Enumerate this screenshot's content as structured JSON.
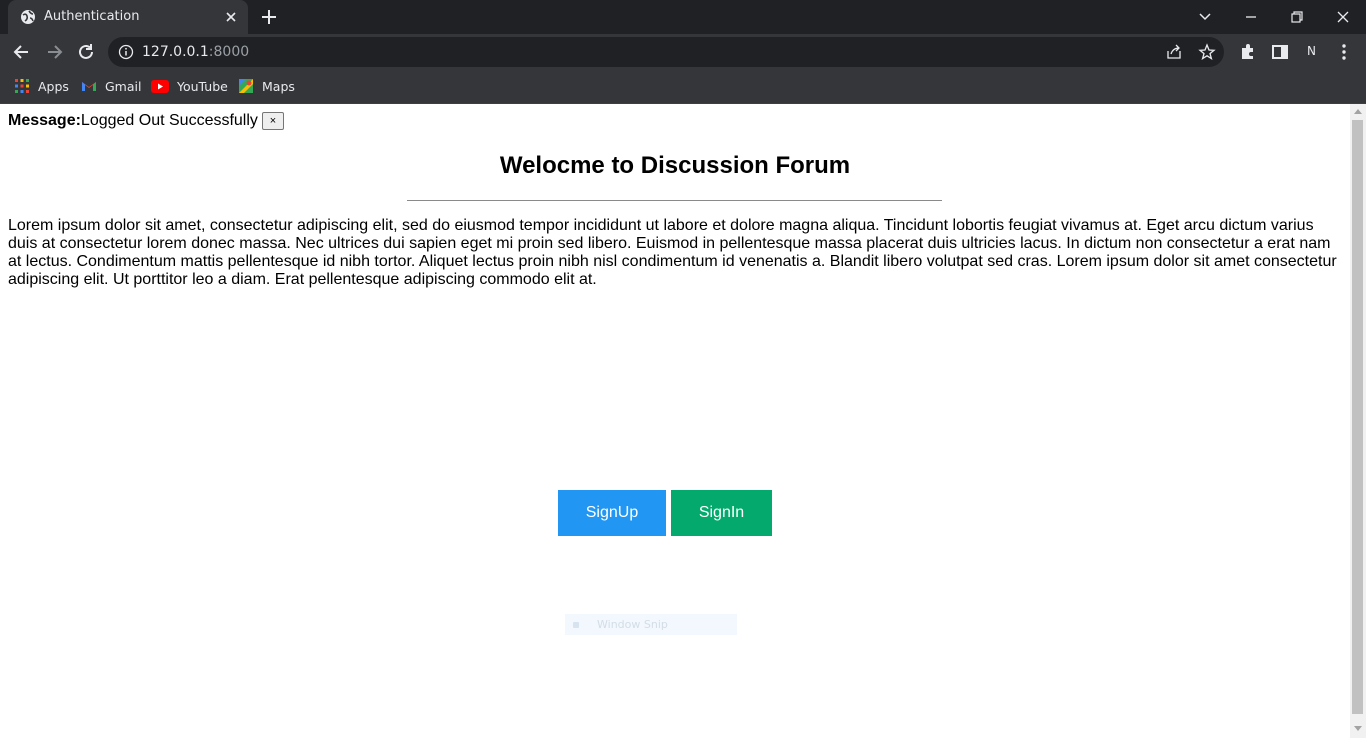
{
  "browser": {
    "tab_title": "Authentication",
    "url_host": "127.0.0.1",
    "url_port": ":8000",
    "profile_initial": "N",
    "bookmarks": [
      {
        "label": "Apps",
        "icon": "apps-grid-icon"
      },
      {
        "label": "Gmail",
        "icon": "gmail-icon"
      },
      {
        "label": "YouTube",
        "icon": "youtube-icon"
      },
      {
        "label": "Maps",
        "icon": "maps-icon"
      }
    ]
  },
  "page": {
    "message_label": "Message:",
    "message_text": "Logged Out Successfully",
    "message_close": "×",
    "title": "Welocme to Discussion Forum",
    "body_text": "Lorem ipsum dolor sit amet, consectetur adipiscing elit, sed do eiusmod tempor incididunt ut labore et dolore magna aliqua. Tincidunt lobortis feugiat vivamus at. Eget arcu dictum varius duis at consectetur lorem donec massa. Nec ultrices dui sapien eget mi proin sed libero. Euismod in pellentesque massa placerat duis ultricies lacus. In dictum non consectetur a erat nam at lectus. Condimentum mattis pellentesque id nibh tortor. Aliquet lectus proin nibh nisl condimentum id venenatis a. Blandit libero volutpat sed cras. Lorem ipsum dolor sit amet consectetur adipiscing elit. Ut porttitor leo a diam. Erat pellentesque adipiscing commodo elit at.",
    "signup_label": "SignUp",
    "signin_label": "SignIn",
    "overlay_label": "Window Snip"
  },
  "colors": {
    "signup": "#2196f3",
    "signin": "#04aa6d",
    "chrome_dark": "#202124",
    "chrome_mid": "#35363a"
  }
}
